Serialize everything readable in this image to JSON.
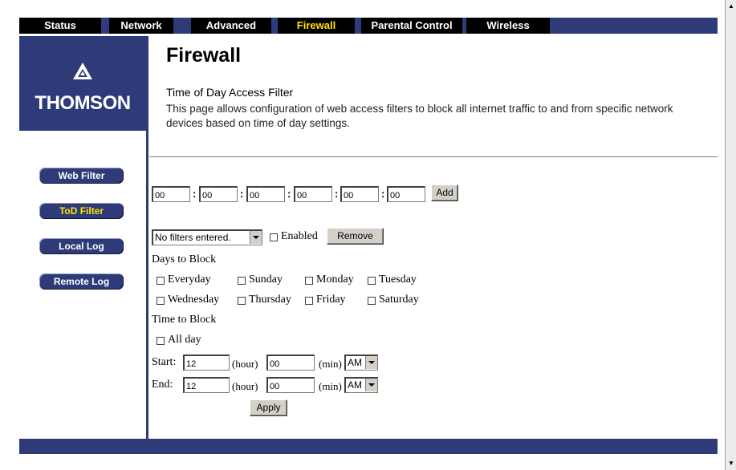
{
  "tabs": [
    {
      "label": "Status"
    },
    {
      "label": "Network"
    },
    {
      "label": "Advanced"
    },
    {
      "label": "Firewall"
    },
    {
      "label": "Parental Control"
    },
    {
      "label": "Wireless"
    }
  ],
  "logo": {
    "text": "THOMSON"
  },
  "page": {
    "title": "Firewall",
    "subtitle": "Time of Day Access Filter",
    "description": "This page allows configuration of web access filters to block all internet traffic to and from specific network devices based on time of day settings."
  },
  "sidebar": [
    {
      "label": "Web Filter"
    },
    {
      "label": "ToD Filter"
    },
    {
      "label": "Local Log"
    },
    {
      "label": "Remote Log"
    }
  ],
  "mac": {
    "fields": [
      "00",
      "00",
      "00",
      "00",
      "00",
      "00"
    ],
    "separator": ":",
    "add_label": "Add"
  },
  "filter": {
    "selected": "No filters entered.",
    "enabled_label": "Enabled",
    "remove_label": "Remove"
  },
  "days": {
    "heading": "Days to Block",
    "row1": [
      "Everyday",
      "Sunday",
      "Monday",
      "Tuesday"
    ],
    "row2": [
      "Wednesday",
      "Thursday",
      "Friday",
      "Saturday"
    ]
  },
  "time": {
    "heading": "Time to Block",
    "allday_label": "All day",
    "start_label": "Start:",
    "end_label": "End:",
    "start_hour": "12",
    "start_min": "00",
    "start_ampm": "AM",
    "end_hour": "12",
    "end_min": "00",
    "end_ampm": "AM",
    "hour_unit": "(hour)",
    "min_unit": "(min)",
    "apply_label": "Apply"
  },
  "colors": {
    "brand": "#2f3b78",
    "active_tab": "#ffe600"
  }
}
